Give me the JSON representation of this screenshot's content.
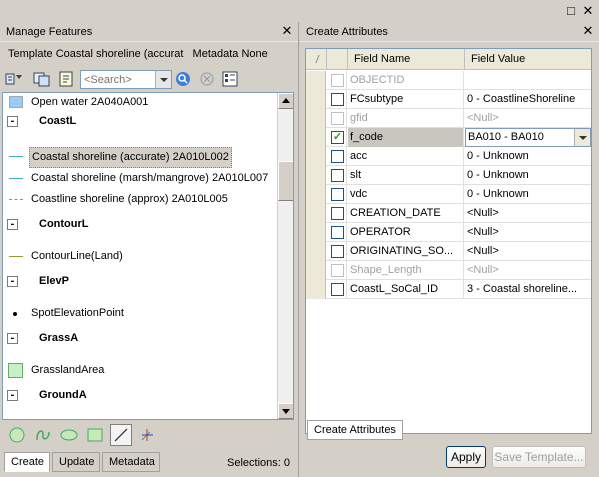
{
  "window": {
    "maximize_glyph": "□",
    "close_glyph": "✕"
  },
  "left_pane": {
    "title": "Manage Features",
    "close_glyph": "✕",
    "template_label": "Template Coastal shoreline (accurat",
    "metadata_label": "Metadata None",
    "search_placeholder": "<Search>",
    "features": [
      {
        "type": "item",
        "label": "Open water 2A040A001",
        "swatch": "#99ccee"
      },
      {
        "type": "group",
        "label": "CoastL"
      },
      {
        "type": "item",
        "label": "Coastal shoreline (accurate) 2A010L002",
        "swatch": "line-cyan",
        "selected": true
      },
      {
        "type": "item",
        "label": "Coastal shoreline (marsh/mangrove) 2A010L007",
        "swatch": "line-cyan"
      },
      {
        "type": "item",
        "label": "Coastline shoreline (approx) 2A010L005",
        "swatch": "line-cyan-dash"
      },
      {
        "type": "group",
        "label": "ContourL"
      },
      {
        "type": "item",
        "label": "ContourLine(Land)",
        "swatch": "line-olive"
      },
      {
        "type": "group",
        "label": "ElevP"
      },
      {
        "type": "item",
        "label": "SpotElevationPoint",
        "swatch": "point"
      },
      {
        "type": "group",
        "label": "GrassA"
      },
      {
        "type": "item",
        "label": "GrasslandArea",
        "swatch": "#c8f0c8"
      },
      {
        "type": "group",
        "label": "GroundA"
      }
    ],
    "tabs": [
      "Create",
      "Update",
      "Metadata"
    ],
    "active_tab": "Create",
    "selections": "Selections: 0"
  },
  "right_pane": {
    "title": "Create Attributes",
    "close_glyph": "✕",
    "columns": [
      "Field Name",
      "Field Value"
    ],
    "rows": [
      {
        "name": "OBJECTID",
        "value": "",
        "checked": false,
        "disabled": true
      },
      {
        "name": "FCsubtype",
        "value": "0 - CoastlineShoreline",
        "checked": false,
        "disabled": false
      },
      {
        "name": "gfid",
        "value": "<Null>",
        "checked": false,
        "disabled": true
      },
      {
        "name": "f_code",
        "value": "BA010 - BA010",
        "checked": true,
        "disabled": false,
        "highlight": true,
        "dropdown": true
      },
      {
        "name": "acc",
        "value": "0 - Unknown",
        "checked": false,
        "disabled": false
      },
      {
        "name": "slt",
        "value": "0 - Unknown",
        "checked": false,
        "disabled": false
      },
      {
        "name": "vdc",
        "value": "0 - Unknown",
        "checked": false,
        "disabled": false
      },
      {
        "name": "CREATION_DATE",
        "value": "<Null>",
        "checked": false,
        "disabled": false
      },
      {
        "name": "OPERATOR",
        "value": "<Null>",
        "checked": false,
        "disabled": false
      },
      {
        "name": "ORIGINATING_SO...",
        "value": "<Null>",
        "checked": false,
        "disabled": false
      },
      {
        "name": "Shape_Length",
        "value": "<Null>",
        "checked": false,
        "disabled": true
      },
      {
        "name": "CoastL_SoCal_ID",
        "value": "3 - Coastal shoreline...",
        "checked": false,
        "disabled": false
      }
    ],
    "tab_label": "Create Attributes",
    "apply_label": "Apply",
    "save_template_label": "Save Template..."
  }
}
